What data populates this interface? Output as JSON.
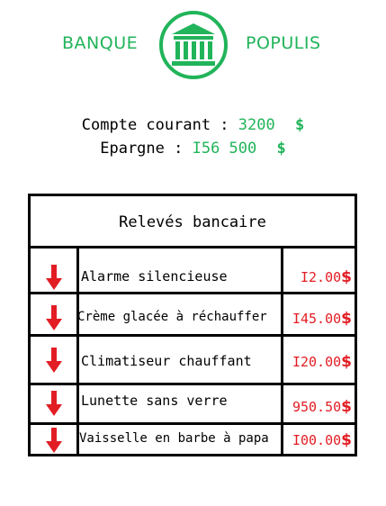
{
  "brand": {
    "left": "BANQUE",
    "right": "POPULIS"
  },
  "balances": {
    "checking": {
      "label": "Compte courant :",
      "amount": "3200",
      "currency": "$"
    },
    "savings": {
      "label": "Epargne :",
      "amount": "I56 500",
      "currency": "$"
    }
  },
  "statement": {
    "title": "Relevés bancaire",
    "rows": [
      {
        "label": "Alarme silencieuse",
        "amount": "I2.00",
        "currency": "$"
      },
      {
        "label": "Crème glacée à réchauffer",
        "amount": "I45.00",
        "currency": "$"
      },
      {
        "label": "Climatiseur chauffant",
        "amount": "I20.00",
        "currency": "$"
      },
      {
        "label": "Lunette sans verre",
        "amount": "950.50",
        "currency": "$"
      },
      {
        "label": "Vaisselle en barbe à papa",
        "amount": "I00.00",
        "currency": "$"
      }
    ]
  },
  "colors": {
    "brand_green": "#21b45a",
    "debit_red": "#e21d24"
  },
  "icons": {
    "logo": "bank-building-icon",
    "row_marker": "arrow-down-icon"
  }
}
